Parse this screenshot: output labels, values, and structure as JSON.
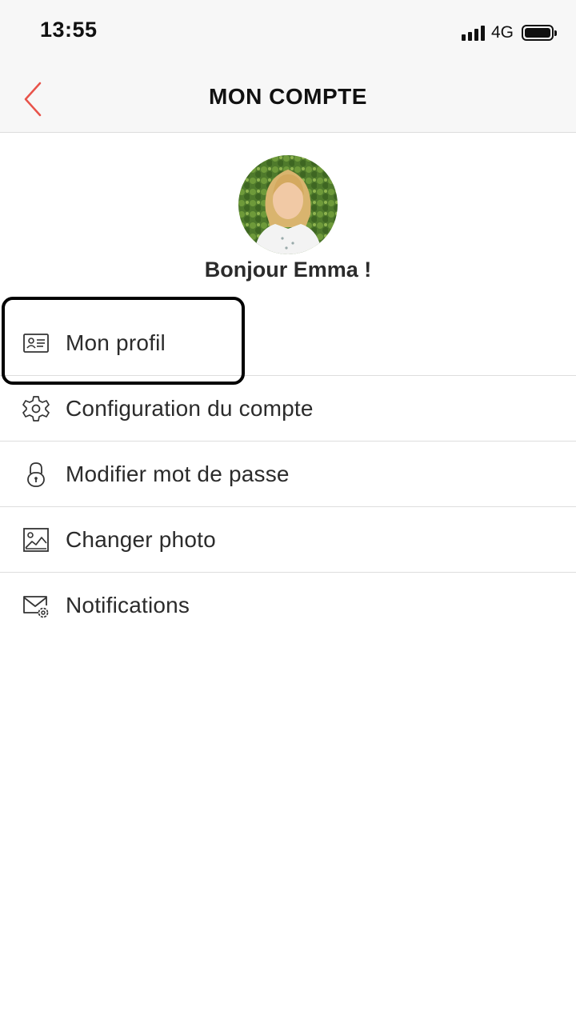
{
  "status_bar": {
    "time": "13:55",
    "network": "4G",
    "icons": [
      "signal-icon",
      "battery-icon"
    ]
  },
  "header": {
    "title": "MON COMPTE",
    "back_icon": "chevron-left-icon",
    "accent_color": "#e8534a"
  },
  "profile": {
    "greeting": "Bonjour Emma !"
  },
  "menu": {
    "items": [
      {
        "label": "Mon profil",
        "icon": "id-card-icon"
      },
      {
        "label": "Configuration du compte",
        "icon": "gear-icon"
      },
      {
        "label": "Modifier mot de passe",
        "icon": "lock-icon"
      },
      {
        "label": "Changer photo",
        "icon": "image-icon"
      },
      {
        "label": "Notifications",
        "icon": "mail-settings-icon"
      }
    ]
  }
}
